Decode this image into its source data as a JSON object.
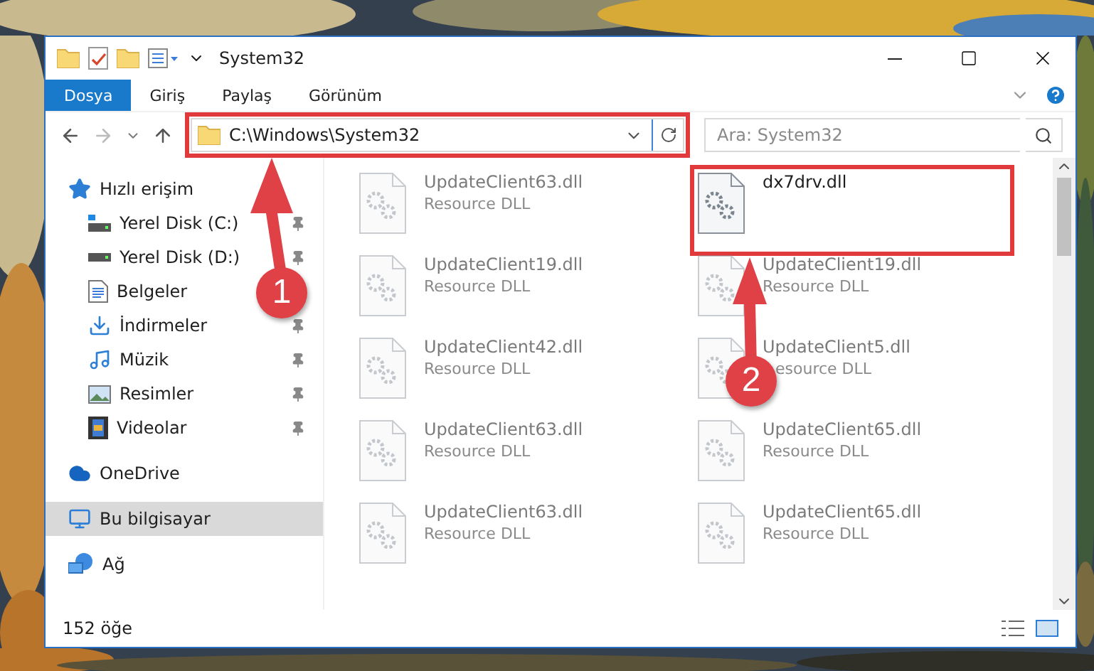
{
  "window": {
    "title": "System32"
  },
  "ribbon": {
    "tabs": [
      {
        "label": "Dosya",
        "selected": true
      },
      {
        "label": "Giriş",
        "selected": false
      },
      {
        "label": "Paylaş",
        "selected": false
      },
      {
        "label": "Görünüm",
        "selected": false
      }
    ]
  },
  "address": {
    "path": "C:\\Windows\\System32",
    "highlighted": true
  },
  "search": {
    "placeholder": "Ara: System32"
  },
  "sidebar": {
    "items": [
      {
        "label": "Hızlı erişim",
        "selected": false,
        "children": [
          {
            "label": "Yerel Disk (C:)",
            "selected": false
          },
          {
            "label": "Yerel Disk (D:)",
            "selected": false
          },
          {
            "label": "Belgeler",
            "selected": false
          },
          {
            "label": "İndirmeler",
            "selected": false
          },
          {
            "label": "Müzik",
            "selected": false
          },
          {
            "label": "Resimler",
            "selected": false
          },
          {
            "label": "Videolar",
            "selected": false
          }
        ]
      },
      {
        "label": "OneDrive",
        "selected": false
      },
      {
        "label": "Bu bilgisayar",
        "selected": true
      },
      {
        "label": "Ağ",
        "selected": false
      }
    ]
  },
  "files": [
    {
      "name": "UpdateClient63.dll",
      "type": "Resource DLL",
      "blurred": true,
      "highlighted": false
    },
    {
      "name": "dx7drv.dll",
      "blurred": false,
      "highlighted": true
    },
    {
      "name": "UpdateClient19.dll",
      "type": "Resource DLL",
      "blurred": true,
      "highlighted": false
    },
    {
      "name": "UpdateClient19.dll",
      "type": "Resource DLL",
      "blurred": true,
      "highlighted": false
    },
    {
      "name": "UpdateClient42.dll",
      "type": "Resource DLL",
      "blurred": true,
      "highlighted": false
    },
    {
      "name": "UpdateClient5.dll",
      "type": "esource DLL",
      "blurred": true,
      "highlighted": false
    },
    {
      "name": "UpdateClient63.dll",
      "type": "Resource DLL",
      "blurred": true,
      "highlighted": false
    },
    {
      "name": "UpdateClient65.dll",
      "type": "Resource DLL",
      "blurred": true,
      "highlighted": false
    },
    {
      "name": "UpdateClient63.dll",
      "type": "Resource DLL",
      "blurred": true,
      "highlighted": false
    },
    {
      "name": "UpdateClient65.dll",
      "type": "Resource DLL",
      "blurred": true,
      "highlighted": false
    }
  ],
  "status_bar": {
    "count": "152 öğe"
  },
  "callouts": [
    {
      "number": "1"
    },
    {
      "number": "2"
    }
  ]
}
